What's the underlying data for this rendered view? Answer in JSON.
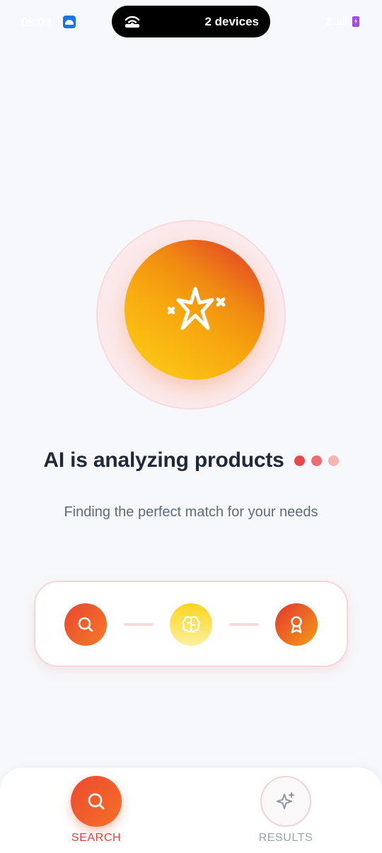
{
  "status_bar": {
    "time": "08:03",
    "hotspot_text": "2 devices",
    "signal_text": "2 .ull",
    "hotspot_icon": "wifi-hotspot-icon",
    "battery_icon": "battery-charging-icon"
  },
  "hero": {
    "icon": "sparkles-icon",
    "title": "AI is analyzing products",
    "subtitle": "Finding the perfect match for your needs"
  },
  "steps": [
    {
      "icon": "search-icon"
    },
    {
      "icon": "brain-icon"
    },
    {
      "icon": "award-icon"
    }
  ],
  "bottom_nav": {
    "search_label": "SEARCH",
    "results_label": "RESULTS",
    "active": "SEARCH"
  },
  "colors": {
    "accent": "#E3443A",
    "orb_start": "#FCD116",
    "orb_end": "#E0332A",
    "inactive": "#9AA4B2"
  }
}
